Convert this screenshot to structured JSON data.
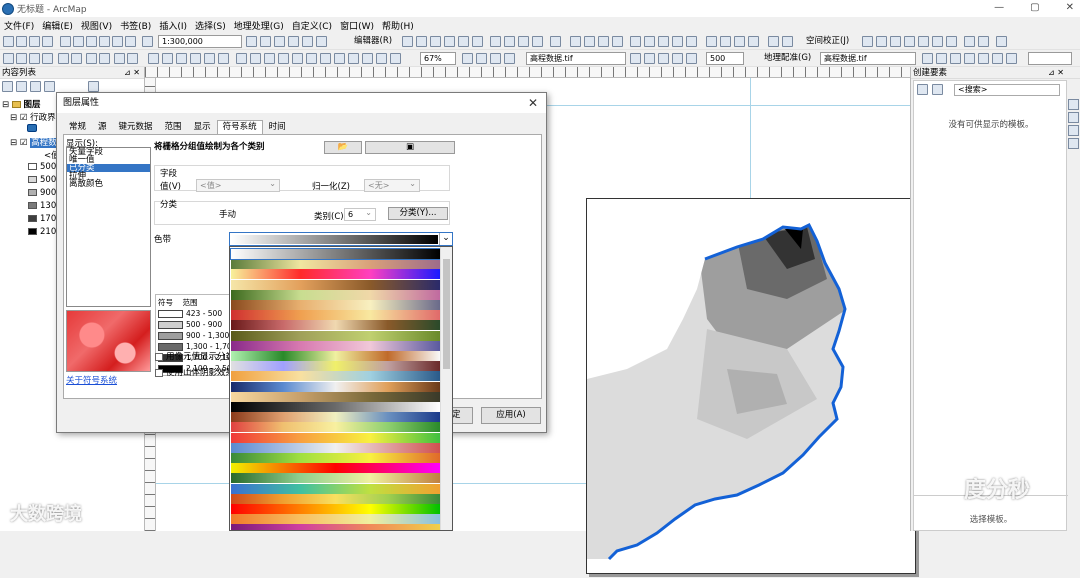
{
  "window": {
    "title": "无标题 - ArcMap",
    "buttons": [
      "—",
      "▢",
      "✕"
    ]
  },
  "menu": [
    "文件(F)",
    "编辑(E)",
    "视图(V)",
    "书签(B)",
    "插入(I)",
    "选择(S)",
    "地理处理(G)",
    "自定义(C)",
    "窗口(W)",
    "帮助(H)"
  ],
  "toolbar": {
    "scale": "1:300,000",
    "editor": "编辑器(R)",
    "layer": "高程数据.tif",
    "zoom": "67%",
    "spatial_adjust": "空间校正(J)",
    "stretch": "500",
    "georef": "地理配准(G)",
    "georef_layer": "高程数据.tif"
  },
  "toc": {
    "title": "内容列表",
    "layers_label": "图层",
    "admin_label": "行政界",
    "raster_label": "高程数",
    "value_label": "<值",
    "legend": [
      "500",
      "500",
      "900",
      "130",
      "170",
      "210"
    ],
    "legend_colors": [
      "#ffffff",
      "#d9d9d9",
      "#b0b0b0",
      "#7a7a7a",
      "#3e3e3e",
      "#000000"
    ]
  },
  "right_panel": {
    "title": "创建要素",
    "search_placeholder": "<搜索>",
    "empty_msg": "没有可供显示的模板。",
    "bottom_msg": "选择模板。"
  },
  "dialog": {
    "title": "图层属性",
    "close": "✕",
    "tabs": [
      "常规",
      "源",
      "键元数据",
      "范围",
      "显示",
      "符号系统",
      "时间"
    ],
    "show_label": "显示(S):",
    "show_items": [
      "矢量字段",
      "唯一值",
      "已分类",
      "拉伸",
      "离散颜色"
    ],
    "selected_show": "已分类",
    "heading": "将栅格分组值绘制为各个类别",
    "field_group": "字段",
    "value_label": "值(V)",
    "value_combo": "<值>",
    "normalize_label": "归一化(Z)",
    "normalize_combo": "<无>",
    "class_group": "分类",
    "class_method": "手动",
    "classes_label": "类别(C)",
    "classes_value": "6",
    "classify_button": "分类(Y)...",
    "ramp_label": "色带",
    "sym_header": [
      "符号",
      "范围"
    ],
    "classes": [
      {
        "range": "423 - 500",
        "color": "#ffffff"
      },
      {
        "range": "500 - 900",
        "color": "#cfcfcf"
      },
      {
        "range": "900 - 1,300",
        "color": "#9e9e9e"
      },
      {
        "range": "1,300 - 1,700",
        "color": "#6a6a6a"
      },
      {
        "range": "1,700 - 2,100",
        "color": "#333333"
      },
      {
        "range": "2,100 - 2,500",
        "color": "#000000"
      }
    ],
    "check_1": "用像元值显示分类",
    "check_2": "使用山体阴影效果",
    "about_link": "关于符号系统",
    "ok": "确定",
    "apply": "应用(A)"
  },
  "ramps": [
    [
      "#ffffff",
      "#000000"
    ],
    [
      "#5a7b3a",
      "#f0e6a0",
      "#d9a07a",
      "#9e6c8a"
    ],
    [
      "#f7f19a",
      "#ff2a2a",
      "#ff40c0",
      "#1a1aff"
    ],
    [
      "#f5e6a8",
      "#e3a05c",
      "#8a5a2a",
      "#2a2a6a"
    ],
    [
      "#3d6a1e",
      "#c8dd90",
      "#f0d8a8",
      "#c06aa0"
    ],
    [
      "#8a4a1e",
      "#e8b070",
      "#f8f0c0",
      "#6a6a8a"
    ],
    [
      "#d03030",
      "#f0a050",
      "#f8e8a0",
      "#e06a6a"
    ],
    [
      "#6a1a1a",
      "#c86a6a",
      "#f0d8b0",
      "#8a5a2a",
      "#2a4a2a"
    ],
    [
      "#5a5a1a",
      "#a0a05a",
      "#c0d070",
      "#6a8a2a"
    ],
    [
      "#8a2a8a",
      "#d87ab0",
      "#f0c8d8",
      "#5a5aa0"
    ],
    [
      "#b0f0b0",
      "#2a8a2a",
      "#f0f0a0",
      "#c06a2a",
      "#f8f8f8"
    ],
    [
      "#e0e0e0",
      "#a0a0ff",
      "#f0f06a",
      "#c0a0a0",
      "#6a2a2a"
    ],
    [
      "#f0a040",
      "#f8e0a0",
      "#a0d0e0",
      "#2a5a8a"
    ],
    [
      "#1a2a6a",
      "#5a8ad0",
      "#f0f0f0",
      "#e0a05a",
      "#6a3a1a"
    ],
    [
      "#f8d8a0",
      "#c8a06a",
      "#7a6a3a",
      "#3a3a2a"
    ],
    [
      "#000000",
      "#6a6a6a",
      "#ffffff"
    ],
    [
      "#8a3a1a",
      "#e0a070",
      "#f0f0c0",
      "#6a90c0",
      "#1a3a8a"
    ],
    [
      "#e04040",
      "#f0c070",
      "#f8f0a0",
      "#90d070",
      "#2a8a2a"
    ],
    [
      "#f03a3a",
      "#f8a040",
      "#f8f040",
      "#40c040"
    ],
    [
      "#5a8ad0",
      "#f0f0f0",
      "#d05050"
    ],
    [
      "#3a8a3a",
      "#a0e040",
      "#f8f040",
      "#e06a2a"
    ],
    [
      "#f0f000",
      "#ff0000",
      "#ff00ff"
    ],
    [
      "#2a6a2a",
      "#90d090",
      "#f0f0a0",
      "#c08040"
    ],
    [
      "#3a70d0",
      "#40c0a0",
      "#c0e040",
      "#f0a030"
    ],
    [
      "#d04a1a",
      "#f0a030",
      "#f8e060",
      "#a0d050",
      "#3a8a3a"
    ],
    [
      "#ff0000",
      "#ff8000",
      "#ffff00",
      "#00c000"
    ],
    [
      "#f07a2a",
      "#f8c060",
      "#f0f0a0",
      "#8ac0e0"
    ],
    [
      "#7a1a7a",
      "#d040a0",
      "#f08a5a",
      "#f0d04a"
    ]
  ],
  "watermarks": [
    "大数跨境",
    "度分秒"
  ]
}
